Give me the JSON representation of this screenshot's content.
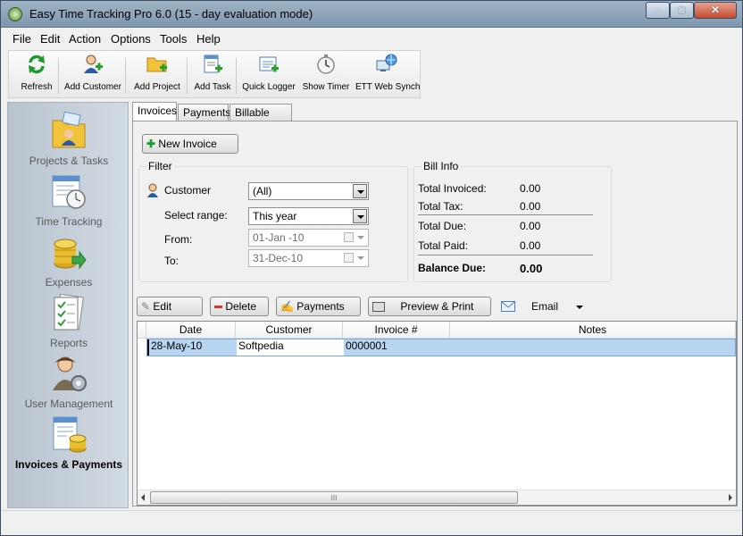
{
  "window": {
    "title": "Easy Time Tracking Pro 6.0 (15 - day evaluation mode)",
    "min_glyph": "–",
    "max_glyph": "□",
    "close_glyph": "✕"
  },
  "menu": [
    "File",
    "Edit",
    "Action",
    "Options",
    "Tools",
    "Help"
  ],
  "toolbar": [
    {
      "label": "Refresh",
      "icon": "refresh-icon"
    },
    {
      "label": "Add Customer",
      "icon": "add-customer-icon"
    },
    {
      "label": "Add Project",
      "icon": "add-project-icon"
    },
    {
      "label": "Add Task",
      "icon": "add-task-icon"
    },
    {
      "label": "Quick Logger",
      "icon": "quick-logger-icon"
    },
    {
      "label": "Show Timer",
      "icon": "timer-icon"
    },
    {
      "label": "ETT Web Synch",
      "icon": "web-synch-icon"
    }
  ],
  "sidebar": [
    {
      "label": "Projects & Tasks",
      "icon": "folder-person-icon"
    },
    {
      "label": "Time Tracking",
      "icon": "clock-document-icon"
    },
    {
      "label": "Expenses",
      "icon": "coins-icon"
    },
    {
      "label": "Reports",
      "icon": "checklist-icon"
    },
    {
      "label": "User Management",
      "icon": "user-gear-icon"
    },
    {
      "label": "Invoices & Payments",
      "icon": "invoice-coins-icon",
      "active": true
    }
  ],
  "tabs": [
    "Invoices",
    "Payments",
    "Billable Items"
  ],
  "new_invoice_label": "New Invoice",
  "filter": {
    "title": "Filter",
    "customer_label": "Customer",
    "customer_value": "(All)",
    "range_label": "Select range:",
    "range_value": "This year",
    "from_label": "From:",
    "from_value": "01-Jan -10",
    "to_label": "To:",
    "to_value": "31-Dec-10"
  },
  "bill_info": {
    "title": "Bill Info",
    "total_invoiced_label": "Total Invoiced:",
    "total_invoiced_value": "0.00",
    "total_tax_label": "Total Tax:",
    "total_tax_value": "0.00",
    "total_due_label": "Total Due:",
    "total_due_value": "0.00",
    "total_paid_label": "Total Paid:",
    "total_paid_value": "0.00",
    "balance_due_label": "Balance Due:",
    "balance_due_value": "0.00"
  },
  "actions": {
    "edit": "Edit",
    "delete": "Delete",
    "payments": "Payments",
    "preview_print": "Preview & Print",
    "email": "Email"
  },
  "grid": {
    "columns": [
      "Date",
      "Customer",
      "Invoice #",
      "Notes"
    ],
    "rows": [
      {
        "date": "28-May-10",
        "customer": "Softpedia",
        "invoice": "0000001",
        "notes": ""
      }
    ],
    "scroll_grip": "III"
  }
}
